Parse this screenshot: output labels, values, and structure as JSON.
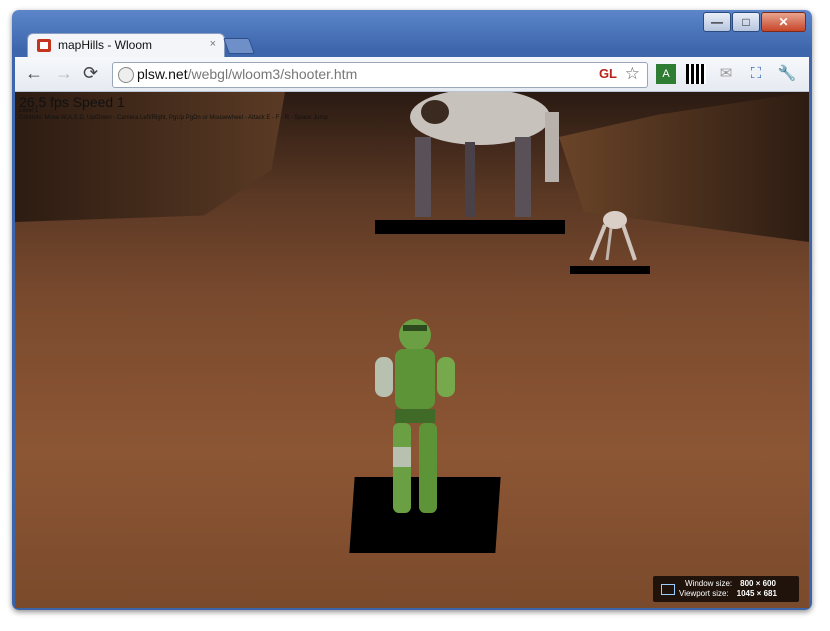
{
  "window": {
    "tab_title": "mapHills - Wloom",
    "tab_close": "×"
  },
  "toolbar": {
    "back": "←",
    "forward": "→",
    "reload": "⟳",
    "url_domain": "plsw.net",
    "url_path": "/webgl/wloom3/shooter.htm",
    "gl_badge": "GL"
  },
  "game": {
    "fps_text": "26.5 fps Speed 1",
    "line2": "Level 1",
    "line3": "Controls: Move W,A,S,D, Up/Down - Camera Left/Right, PgUp PgDn or Mousewheel - Attack E - F - R - Space Jump"
  },
  "size_overlay": {
    "window_label": "Window size:",
    "window_value": "800 × 600",
    "viewport_label": "Viewport size:",
    "viewport_value": "1045 × 681"
  }
}
